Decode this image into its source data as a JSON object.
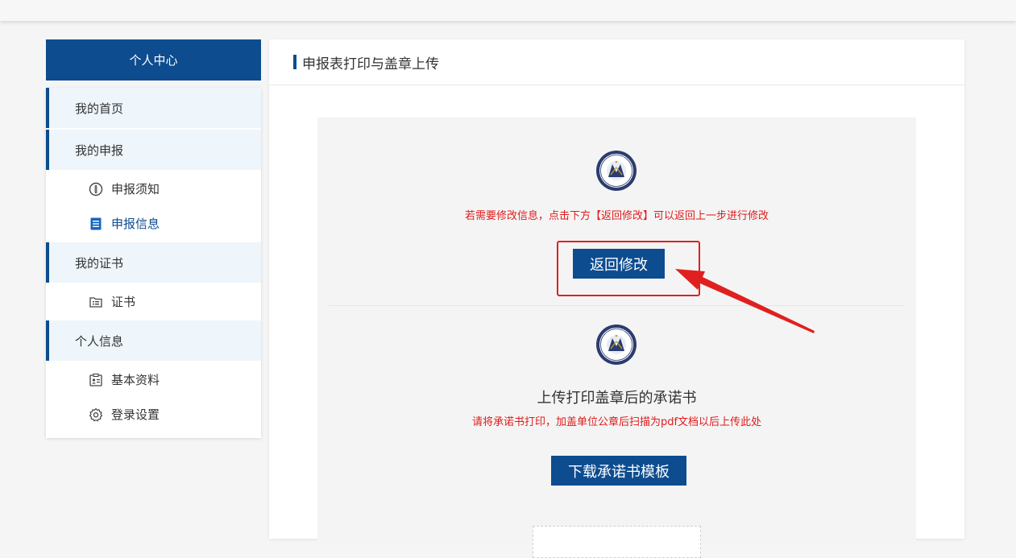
{
  "sidebar": {
    "header": "个人中心",
    "groups": [
      {
        "label": "我的首页"
      },
      {
        "label": "我的申报"
      },
      {
        "label": "我的证书"
      },
      {
        "label": "个人信息"
      }
    ],
    "sub_items": {
      "notice": "申报须知",
      "info": "申报信息",
      "certificate": "证书",
      "profile": "基本资料",
      "login_settings": "登录设置"
    }
  },
  "main": {
    "title": "申报表打印与盖章上传",
    "modify_notice": "若需要修改信息，点击下方【返回修改】可以返回上一步进行修改",
    "return_button": "返回修改",
    "upload_title": "上传打印盖章后的承诺书",
    "upload_notice": "请将承诺书打印，加盖单位公章后扫描为pdf文档以后上传此处",
    "download_button": "下载承诺书模板"
  },
  "colors": {
    "brand_blue": "#0d4c8f",
    "alert_red": "#e01b1b",
    "annotation_red": "#e02020"
  }
}
